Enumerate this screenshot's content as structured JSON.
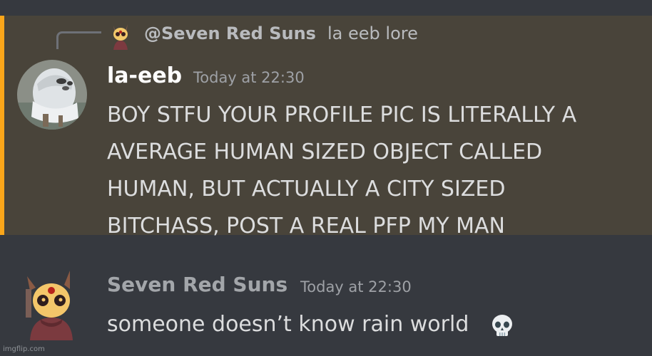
{
  "reply": {
    "name": "@Seven Red Suns",
    "text": "la eeb lore",
    "avatar_icon": "seven-red-suns-avatar-icon"
  },
  "message_1": {
    "username": "la-eeb",
    "timestamp": "Today at 22:30",
    "content": "BOY STFU YOUR PROFILE PIC IS LITERALLY A\nAVERAGE HUMAN SIZED OBJECT CALLED\nHUMAN, BUT ACTUALLY A CITY SIZED\nBITCHASS, POST A REAL PFP MY MAN",
    "avatar_icon": "la-eeb-avatar-icon",
    "mentioned": true
  },
  "message_2": {
    "username": "Seven Red Suns",
    "timestamp": "Today at 22:30",
    "content": "someone doesn’t know rain world",
    "emoji": "skull-emoji-icon",
    "avatar_icon": "seven-red-suns-avatar-icon"
  },
  "watermark": "imgflip.com",
  "colors": {
    "background": "#36393f",
    "mention_highlight": "#49443a",
    "mention_bar": "#faa61a"
  }
}
